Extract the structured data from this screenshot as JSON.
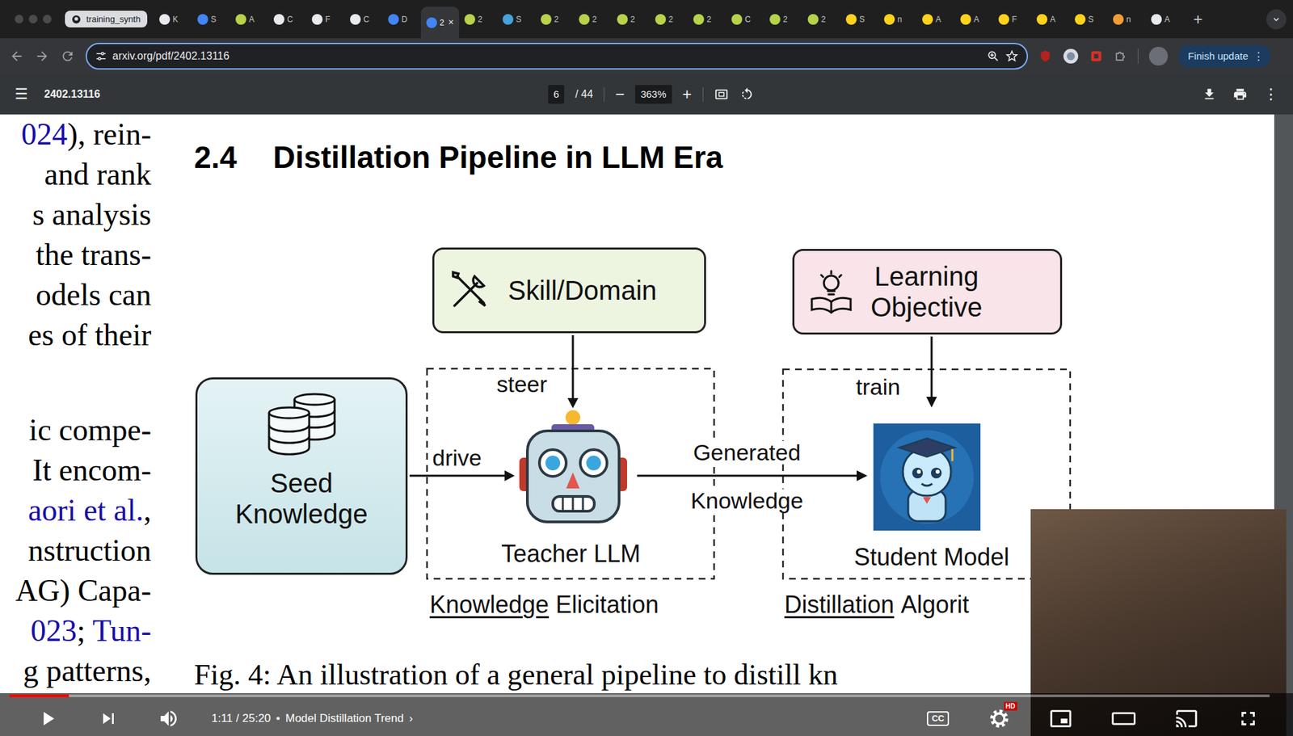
{
  "tab_group": {
    "label": "training_synth"
  },
  "tabs": [
    {
      "label": "K",
      "selected": false,
      "color": "#e8eaed"
    },
    {
      "label": "S",
      "selected": false,
      "color": "#4285f4"
    },
    {
      "label": "A",
      "selected": false,
      "color": "#b8d24a"
    },
    {
      "label": "C",
      "selected": false,
      "color": "#e8eaed"
    },
    {
      "label": "F",
      "selected": false,
      "color": "#e8eaed"
    },
    {
      "label": "C",
      "selected": false,
      "color": "#e8eaed"
    },
    {
      "label": "D",
      "selected": false,
      "color": "#4285f4"
    },
    {
      "label": "2",
      "selected": true,
      "color": "#4285f4"
    },
    {
      "label": "2",
      "selected": false,
      "color": "#b8d24a"
    },
    {
      "label": "S",
      "selected": false,
      "color": "#46a2da"
    },
    {
      "label": "2",
      "selected": false,
      "color": "#b8d24a"
    },
    {
      "label": "2",
      "selected": false,
      "color": "#b8d24a"
    },
    {
      "label": "2",
      "selected": false,
      "color": "#b8d24a"
    },
    {
      "label": "2",
      "selected": false,
      "color": "#b8d24a"
    },
    {
      "label": "2",
      "selected": false,
      "color": "#b8d24a"
    },
    {
      "label": "C",
      "selected": false,
      "color": "#b8d24a"
    },
    {
      "label": "2",
      "selected": false,
      "color": "#b8d24a"
    },
    {
      "label": "2",
      "selected": false,
      "color": "#b8d24a"
    },
    {
      "label": "S",
      "selected": false,
      "color": "#ffd21e"
    },
    {
      "label": "n",
      "selected": false,
      "color": "#ffd21e"
    },
    {
      "label": "A",
      "selected": false,
      "color": "#ffd21e"
    },
    {
      "label": "A",
      "selected": false,
      "color": "#ffd21e"
    },
    {
      "label": "F",
      "selected": false,
      "color": "#ffd21e"
    },
    {
      "label": "A",
      "selected": false,
      "color": "#ffd21e"
    },
    {
      "label": "S",
      "selected": false,
      "color": "#ffd21e"
    },
    {
      "label": "n",
      "selected": false,
      "color": "#f29d38"
    },
    {
      "label": "A",
      "selected": false,
      "color": "#e8eaed"
    }
  ],
  "tab_close": "×",
  "new_tab": "+",
  "address_bar": {
    "url": "arxiv.org/pdf/2402.13116"
  },
  "update_button": {
    "label": "Finish update",
    "menu": "⋮"
  },
  "pdf_toolbar": {
    "menu": "☰",
    "title": "2402.13116",
    "page": "6",
    "page_count": "/ 44",
    "zoom_out": "−",
    "zoom": "363%",
    "zoom_in": "+",
    "more": "⋮"
  },
  "paper": {
    "left_column": [
      [
        [
          {
            "text": "024",
            "link": true
          },
          {
            "text": "), rein-",
            "link": false
          }
        ],
        [
          {
            "text": "and rank",
            "link": false
          }
        ],
        [
          {
            "text": "s analysis",
            "link": false
          }
        ],
        [
          {
            "text": "the trans-",
            "link": false
          }
        ],
        [
          {
            "text": "odels can",
            "link": false
          }
        ],
        [
          {
            "text": "es of their",
            "link": false
          }
        ]
      ],
      [
        [
          {
            "text": "ic compe-",
            "link": false
          }
        ],
        [
          {
            "text": "It encom-",
            "link": false
          }
        ],
        [
          {
            "text": "aori et al.",
            "link": true
          },
          {
            "text": ",",
            "link": false
          }
        ],
        [
          {
            "text": "nstruction",
            "link": false
          }
        ],
        [
          {
            "text": "AG) Capa-",
            "link": false
          }
        ],
        [
          {
            "text": "023",
            "link": true
          },
          {
            "text": "; ",
            "link": false
          },
          {
            "text": "Tun-",
            "link": true
          }
        ],
        [
          {
            "text": "g patterns,",
            "link": false
          }
        ]
      ]
    ],
    "section_number": "2.4",
    "section_title": "Distillation Pipeline in LLM Era",
    "caption": "Fig. 4: An illustration of a general pipeline to distill kn"
  },
  "diagram": {
    "skill": {
      "label": "Skill/Domain"
    },
    "objective": {
      "lines": [
        "Learning",
        "Objective"
      ]
    },
    "seed": {
      "lines": [
        "Seed",
        "Knowledge"
      ]
    },
    "teacher": {
      "label": "Teacher LLM"
    },
    "student": {
      "label": "Student Model"
    },
    "edges": {
      "steer": "steer",
      "drive": "drive",
      "generated": [
        "Generated",
        "Knowledge"
      ],
      "train": "train"
    },
    "stages": [
      {
        "underlined": "Knowledge",
        "rest": "Elicitation"
      },
      {
        "underlined": "Distillation",
        "rest": "Algorit"
      }
    ]
  },
  "video_player": {
    "time": "1:11 / 25:20",
    "separator": "•",
    "chapter": "Model Distillation Trend",
    "chapter_arrow": "›",
    "progress": {
      "level": 0.047
    },
    "captions": "CC",
    "quality_badge": "HD"
  }
}
